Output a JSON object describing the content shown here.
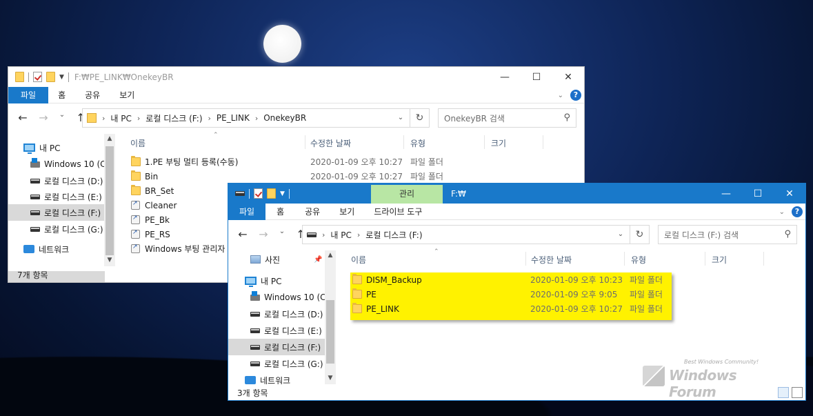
{
  "win1": {
    "title": "F:₩PE_LINK₩OnekeyBR",
    "ribbon": {
      "file": "파일",
      "home": "홈",
      "share": "공유",
      "view": "보기"
    },
    "address": [
      "내 PC",
      "로컬 디스크 (F:)",
      "PE_LINK",
      "OnekeyBR"
    ],
    "search_placeholder": "OnekeyBR 검색",
    "nav": [
      "내 PC",
      "Windows 10 (C:",
      "로컬 디스크 (D:)",
      "로컬 디스크 (E:)",
      "로컬 디스크 (F:)",
      "로컬 디스크 (G:)",
      "네트워크"
    ],
    "columns": {
      "name": "이름",
      "modified": "수정한 날짜",
      "type": "유형",
      "size": "크기"
    },
    "files": [
      {
        "name": "1.PE 부팅 멀티 등록(수동)",
        "date": "2020-01-09 오후 10:27",
        "type": "파일 폴더",
        "icon": "folder-icon"
      },
      {
        "name": "Bin",
        "date": "2020-01-09 오후 10:27",
        "type": "파일 폴더",
        "icon": "folder-icon"
      },
      {
        "name": "BR_Set",
        "date": "",
        "type": "",
        "icon": "folder-icon"
      },
      {
        "name": "Cleaner",
        "date": "",
        "type": "",
        "icon": "shortcut-icon"
      },
      {
        "name": "PE_Bk",
        "date": "",
        "type": "",
        "icon": "shortcut-icon"
      },
      {
        "name": "PE_RS",
        "date": "",
        "type": "",
        "icon": "shortcut-icon"
      },
      {
        "name": "Windows 부팅 관리자",
        "date": "",
        "type": "",
        "icon": "shortcut-icon"
      }
    ],
    "status": "7개 항목"
  },
  "win2": {
    "context_tab": "관리",
    "title": "F:₩",
    "ribbon": {
      "file": "파일",
      "home": "홈",
      "share": "공유",
      "view": "보기",
      "drive_tools": "드라이브 도구"
    },
    "address": [
      "내 PC",
      "로컬 디스크 (F:)"
    ],
    "search_placeholder": "로컬 디스크 (F:) 검색",
    "nav": [
      "사진",
      "내 PC",
      "Windows 10 (C:",
      "로컬 디스크 (D:)",
      "로컬 디스크 (E:)",
      "로컬 디스크 (F:)",
      "로컬 디스크 (G:)",
      "네트워크"
    ],
    "columns": {
      "name": "이름",
      "modified": "수정한 날짜",
      "type": "유형",
      "size": "크기"
    },
    "files": [
      {
        "name": "DISM_Backup",
        "date": "2020-01-09 오후 10:23",
        "type": "파일 폴더"
      },
      {
        "name": "PE",
        "date": "2020-01-09 오후 9:05",
        "type": "파일 폴더"
      },
      {
        "name": "PE_LINK",
        "date": "2020-01-09 오후 10:27",
        "type": "파일 폴더"
      }
    ],
    "status": "3개 항목",
    "highlight_color": "#fff200"
  },
  "watermark": {
    "tagline": "Best Windows Community!",
    "brand": "Windows Forum"
  },
  "colors": {
    "accent": "#1979ca",
    "context_tab": "#b8e6a4"
  }
}
